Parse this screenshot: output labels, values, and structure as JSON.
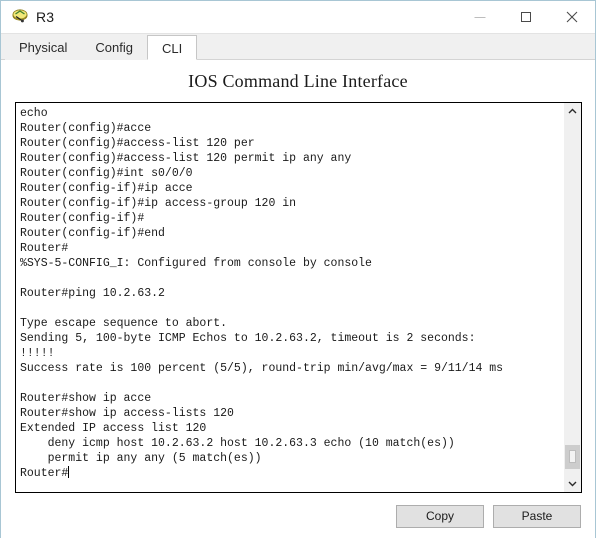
{
  "window": {
    "title": "R3",
    "icon": "router-icon",
    "controls": [
      {
        "name": "minimize-button",
        "glyph": "minimize-icon"
      },
      {
        "name": "maximize-button",
        "glyph": "maximize-icon"
      },
      {
        "name": "close-button",
        "glyph": "close-icon"
      }
    ]
  },
  "tabs": [
    {
      "label": "Physical",
      "active": false
    },
    {
      "label": "Config",
      "active": false
    },
    {
      "label": "CLI",
      "active": true
    }
  ],
  "panel": {
    "heading": "IOS Command Line Interface"
  },
  "terminal": {
    "lines": [
      "echo",
      "Router(config)#acce",
      "Router(config)#access-list 120 per",
      "Router(config)#access-list 120 permit ip any any",
      "Router(config)#int s0/0/0",
      "Router(config-if)#ip acce",
      "Router(config-if)#ip access-group 120 in",
      "Router(config-if)#",
      "Router(config-if)#end",
      "Router#",
      "%SYS-5-CONFIG_I: Configured from console by console",
      "",
      "Router#ping 10.2.63.2",
      "",
      "Type escape sequence to abort.",
      "Sending 5, 100-byte ICMP Echos to 10.2.63.2, timeout is 2 seconds:",
      "!!!!!",
      "Success rate is 100 percent (5/5), round-trip min/avg/max = 9/11/14 ms",
      "",
      "Router#show ip acce",
      "Router#show ip access-lists 120",
      "Extended IP access list 120",
      "    deny icmp host 10.2.63.2 host 10.2.63.3 echo (10 match(es))",
      "    permit ip any any (5 match(es))"
    ],
    "prompt": "Router#",
    "scrollbar": {
      "up_arrow": "chevron-up-icon",
      "down_arrow": "chevron-down-icon"
    }
  },
  "buttons": {
    "copy_label": "Copy",
    "paste_label": "Paste"
  },
  "colors": {
    "window_border": "#a8c6d4",
    "tab_active_bg": "#ffffff",
    "chrome_bg": "#f0f0f0",
    "terminal_bg": "#ffffff",
    "terminal_fg": "#1a1a1a",
    "button_bg": "#e1e1e1"
  }
}
